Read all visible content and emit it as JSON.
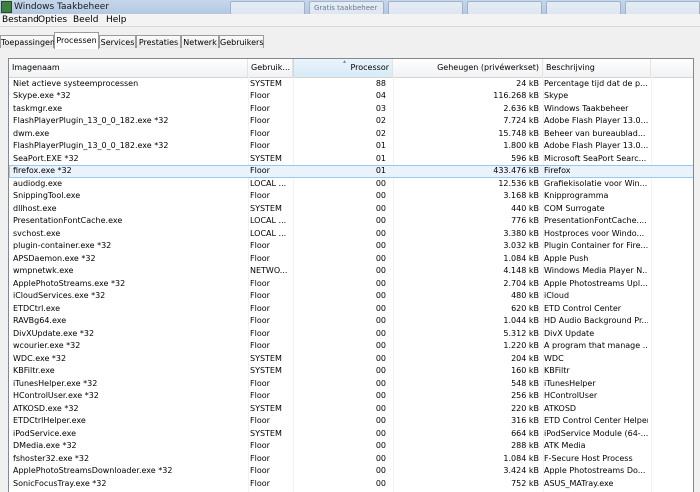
{
  "window": {
    "title": "Windows Taakbeheer"
  },
  "ghost_tabs": [
    "",
    "Gratis taakbeheer",
    "",
    "",
    "",
    ""
  ],
  "menu": [
    {
      "label": "Bestand"
    },
    {
      "label": "Opties"
    },
    {
      "label": "Beeld"
    },
    {
      "label": "Help"
    }
  ],
  "tabs": [
    {
      "label": "Toepassingen"
    },
    {
      "label": "Processen",
      "active": true
    },
    {
      "label": "Services"
    },
    {
      "label": "Prestaties"
    },
    {
      "label": "Netwerk"
    },
    {
      "label": "Gebruikers"
    }
  ],
  "columns": [
    "Imagenaam",
    "Gebruik...",
    "Processor",
    "Geheugen (privéwerkset)",
    "Beschrijving"
  ],
  "sorted_column": "Processor",
  "selected_row": 7,
  "rows": [
    {
      "name": "Niet actieve systeemprocessen",
      "user": "SYSTEM",
      "cpu": "88",
      "mem": "24 kB",
      "desc": "Percentage tijd dat de p..."
    },
    {
      "name": "Skype.exe *32",
      "user": "Floor",
      "cpu": "04",
      "mem": "116.268 kB",
      "desc": "Skype"
    },
    {
      "name": "taskmgr.exe",
      "user": "Floor",
      "cpu": "03",
      "mem": "2.636 kB",
      "desc": "Windows Taakbeheer"
    },
    {
      "name": "FlashPlayerPlugin_13_0_0_182.exe *32",
      "user": "Floor",
      "cpu": "02",
      "mem": "7.724 kB",
      "desc": "Adobe Flash Player 13.0..."
    },
    {
      "name": "dwm.exe",
      "user": "Floor",
      "cpu": "02",
      "mem": "15.748 kB",
      "desc": "Beheer van bureaublad..."
    },
    {
      "name": "FlashPlayerPlugin_13_0_0_182.exe *32",
      "user": "Floor",
      "cpu": "01",
      "mem": "1.800 kB",
      "desc": "Adobe Flash Player 13.0..."
    },
    {
      "name": "SeaPort.EXE *32",
      "user": "SYSTEM",
      "cpu": "01",
      "mem": "596 kB",
      "desc": "Microsoft SeaPort Searc..."
    },
    {
      "name": "firefox.exe *32",
      "user": "Floor",
      "cpu": "01",
      "mem": "433.476 kB",
      "desc": "Firefox"
    },
    {
      "name": "audiodg.exe",
      "user": "LOCAL ...",
      "cpu": "00",
      "mem": "12.536 kB",
      "desc": "Grafiekisolatie voor Win..."
    },
    {
      "name": "SnippingTool.exe",
      "user": "Floor",
      "cpu": "00",
      "mem": "3.168 kB",
      "desc": "Knipprogramma"
    },
    {
      "name": "dllhost.exe",
      "user": "SYSTEM",
      "cpu": "00",
      "mem": "440 kB",
      "desc": "COM Surrogate"
    },
    {
      "name": "PresentationFontCache.exe",
      "user": "LOCAL ...",
      "cpu": "00",
      "mem": "776 kB",
      "desc": "PresentationFontCache...."
    },
    {
      "name": "svchost.exe",
      "user": "LOCAL ...",
      "cpu": "00",
      "mem": "3.380 kB",
      "desc": "Hostproces voor Windo..."
    },
    {
      "name": "plugin-container.exe *32",
      "user": "Floor",
      "cpu": "00",
      "mem": "3.032 kB",
      "desc": "Plugin Container for Fire..."
    },
    {
      "name": "APSDaemon.exe *32",
      "user": "Floor",
      "cpu": "00",
      "mem": "1.084 kB",
      "desc": "Apple Push"
    },
    {
      "name": "wmpnetwk.exe",
      "user": "NETWO...",
      "cpu": "00",
      "mem": "4.148 kB",
      "desc": "Windows Media Player N..."
    },
    {
      "name": "ApplePhotoStreams.exe *32",
      "user": "Floor",
      "cpu": "00",
      "mem": "2.704 kB",
      "desc": "Apple Photostreams Upl..."
    },
    {
      "name": "iCloudServices.exe *32",
      "user": "Floor",
      "cpu": "00",
      "mem": "480 kB",
      "desc": "iCloud"
    },
    {
      "name": "ETDCtrl.exe",
      "user": "Floor",
      "cpu": "00",
      "mem": "620 kB",
      "desc": "ETD Control Center"
    },
    {
      "name": "RAVBg64.exe",
      "user": "Floor",
      "cpu": "00",
      "mem": "1.044 kB",
      "desc": "HD Audio Background Pr..."
    },
    {
      "name": "DivXUpdate.exe *32",
      "user": "Floor",
      "cpu": "00",
      "mem": "5.312 kB",
      "desc": "DivX Update"
    },
    {
      "name": "wcourier.exe *32",
      "user": "Floor",
      "cpu": "00",
      "mem": "1.220 kB",
      "desc": "A program that manage ..."
    },
    {
      "name": "WDC.exe *32",
      "user": "SYSTEM",
      "cpu": "00",
      "mem": "204 kB",
      "desc": "WDC"
    },
    {
      "name": "KBFiltr.exe",
      "user": "SYSTEM",
      "cpu": "00",
      "mem": "160 kB",
      "desc": "KBFiltr"
    },
    {
      "name": "iTunesHelper.exe *32",
      "user": "Floor",
      "cpu": "00",
      "mem": "548 kB",
      "desc": "iTunesHelper"
    },
    {
      "name": "HControlUser.exe *32",
      "user": "Floor",
      "cpu": "00",
      "mem": "256 kB",
      "desc": "HControlUser"
    },
    {
      "name": "ATKOSD.exe *32",
      "user": "SYSTEM",
      "cpu": "00",
      "mem": "220 kB",
      "desc": "ATKOSD"
    },
    {
      "name": "ETDCtrlHelper.exe",
      "user": "Floor",
      "cpu": "00",
      "mem": "316 kB",
      "desc": "ETD Control Center Helper"
    },
    {
      "name": "iPodService.exe",
      "user": "SYSTEM",
      "cpu": "00",
      "mem": "664 kB",
      "desc": "iPodService Module (64-..."
    },
    {
      "name": "DMedia.exe *32",
      "user": "Floor",
      "cpu": "00",
      "mem": "288 kB",
      "desc": "ATK Media"
    },
    {
      "name": "fshoster32.exe *32",
      "user": "Floor",
      "cpu": "00",
      "mem": "1.084 kB",
      "desc": "F-Secure Host Process"
    },
    {
      "name": "ApplePhotoStreamsDownloader.exe *32",
      "user": "Floor",
      "cpu": "00",
      "mem": "3.424 kB",
      "desc": "Apple Photostreams Do..."
    },
    {
      "name": "SonicFocusTray.exe *32",
      "user": "Floor",
      "cpu": "00",
      "mem": "752 kB",
      "desc": "ASUS_MATray.exe"
    }
  ]
}
